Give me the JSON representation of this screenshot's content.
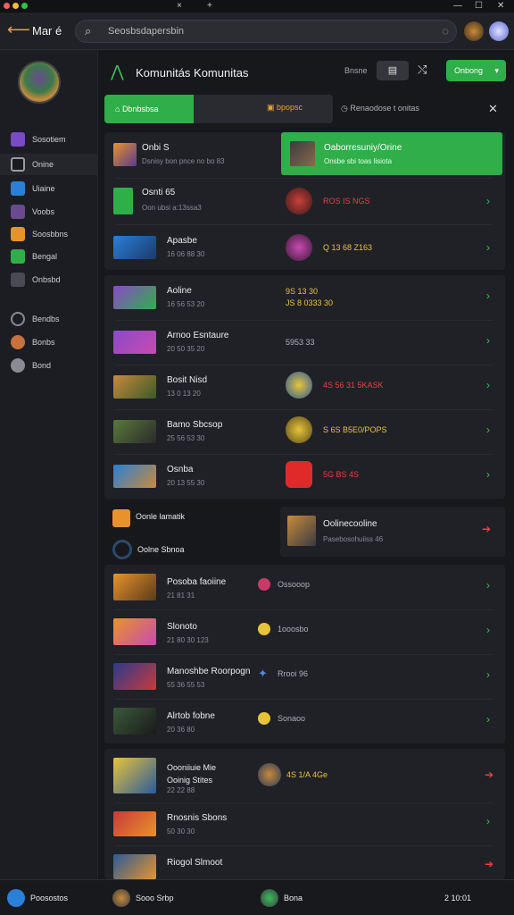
{
  "window": {
    "tab_close": "×",
    "new_tab": "+"
  },
  "nav": {
    "title": "Mar é",
    "search_placeholder": "Seosbsdapersbin"
  },
  "sidebar": {
    "items": [
      {
        "label": "Sosotiem",
        "color": "#7a4ac9"
      },
      {
        "label": "Onine",
        "color": "#3a3b42"
      },
      {
        "label": "Uiaine",
        "color": "#2a7fd9"
      },
      {
        "label": "Voobs",
        "color": "#6a4a8e"
      },
      {
        "label": "Soosbbns",
        "color": "#e8932a"
      },
      {
        "label": "Bengal",
        "color": "#2fae49"
      },
      {
        "label": "Onbsbd",
        "color": "#4a4a52"
      },
      {
        "label": "Bendbs",
        "color": "#3a3b42"
      },
      {
        "label": "Bonbs",
        "color": "#c9713a"
      },
      {
        "label": "Bond",
        "color": "#8a8a92"
      }
    ]
  },
  "main": {
    "title": "Komunitás Komunitas",
    "header_text": "Bnsne",
    "header_btn": "▤",
    "filter_btn": "Onbong",
    "tab_active": "Dbnbsbsa",
    "tab_other": "bpopsc",
    "tab_label": "Renaodose t onitas",
    "highlight": {
      "title": "Oaborresuniy/Orine",
      "sub": "Onsbe sbi toas lisiota"
    },
    "rows1": [
      {
        "title": "Onbi S",
        "sub": "Dsnisy bon pnce no bo 83",
        "value": "",
        "vcolor": "#e0e0e0"
      },
      {
        "title": "Osnti 65",
        "sub": "Oon ubsi a:13ssa3",
        "value": "ROS IS NGS",
        "vcolor": "#e84040"
      },
      {
        "title": "Apasbe",
        "sub": "16 06 88 30",
        "value": "Q 13 68 Z163",
        "vcolor": "#e8c43a"
      }
    ],
    "rows2": [
      {
        "title": "Aoline",
        "sub": "16 56 53 20",
        "value": "9S 13 30\nJS 8 0333 30",
        "vcolor": "#e8c43a"
      },
      {
        "title": "Arnoo Esntaure",
        "sub": "20 50 35 20",
        "value": "5953 33",
        "vcolor": "#b0b0b8"
      },
      {
        "title": "Bosit Nisd",
        "sub": "13 0 13 20",
        "value": "4S 56 31 5KASK",
        "vcolor": "#e84040"
      },
      {
        "title": "Bamo Sbcsop",
        "sub": "25 56 53 30",
        "value": "S 6S B5E0/POPS",
        "vcolor": "#e8c43a"
      },
      {
        "title": "Osnba",
        "sub": "20 13 55 30",
        "value": "5G BS 4S",
        "vcolor": "#e84040"
      }
    ],
    "mid_left1": "Oonle lamatik",
    "mid_left2": "Oolne Sbnoa",
    "mid_right": {
      "title": "Oolinecooline",
      "sub": "Pasebosohuiiss 46"
    },
    "rows3": [
      {
        "title": "Posoba faoiine",
        "sub": "21 81 31",
        "value": "Ossooop"
      },
      {
        "title": "Slonoto",
        "sub": "21 80 30 123",
        "value": "1ooosbo"
      },
      {
        "title": "Manoshbe Roorpogn",
        "sub": "55 36 55 53",
        "value": "Rrooi 96"
      },
      {
        "title": "Alrtob fobne",
        "sub": "20 36 80",
        "value": "Sonaoo"
      }
    ],
    "rows4": [
      {
        "title": "Oooniiuie Mie\nOoinig Stites",
        "sub": "22 22 88",
        "value": "4S 1/A 4Ge"
      },
      {
        "title": "Rnosnis Sbons",
        "sub": "50 30 30",
        "value": ""
      },
      {
        "title": "Riogol Slmoot",
        "sub": "",
        "value": ""
      }
    ]
  },
  "bottom": {
    "left": "Poosostos",
    "mid1": "Sooo Srbp",
    "mid2": "Bona",
    "right": "2  10:01"
  }
}
